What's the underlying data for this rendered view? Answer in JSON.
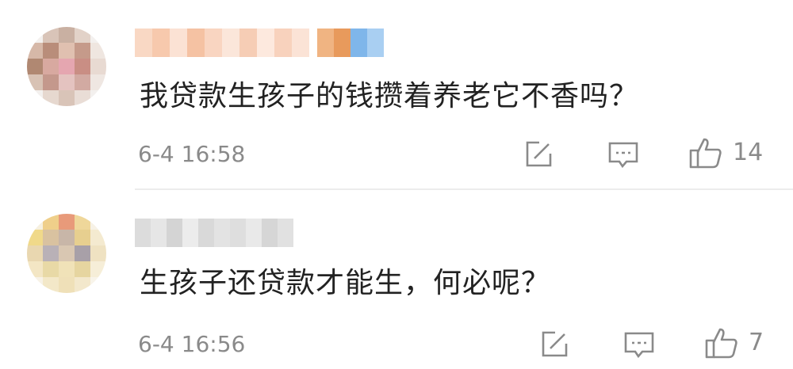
{
  "comments": [
    {
      "text": "我贷款生孩子的钱攒着养老它不香吗？",
      "time": "6-4 16:58",
      "likes": "14",
      "avatar_colors": [
        "#f3f0ee",
        "#d9c4b8",
        "#c9b0a2",
        "#e2d2c8",
        "#f3f0ee",
        "#d6b8a8",
        "#b98d7a",
        "#e0c0b0",
        "#c59a8a",
        "#efe6e0",
        "#b08872",
        "#d8a9a0",
        "#e5a6b0",
        "#c98e84",
        "#e8dad2",
        "#d8c2b4",
        "#c4988c",
        "#e4c3c0",
        "#d2aaa2",
        "#efe7e2",
        "#f3f0ee",
        "#e6d8cf",
        "#d9c4b8",
        "#e9ddd6",
        "#f3f0ee"
      ],
      "name_colors": [
        "#f9d8c4",
        "#f7c9ad",
        "#fbe2d4",
        "#f5c2a3",
        "#f9d5c1",
        "#fbe6da",
        "#f6cdb5",
        "#fde9de",
        "#f8d2bd",
        "#fbe3d6"
      ],
      "badge_colors": [
        "#f0b482",
        "#e89a5c",
        "#7fb6ea",
        "#a9cff2"
      ]
    },
    {
      "text": "生孩子还贷款才能生，何必呢？",
      "time": "6-4 16:56",
      "likes": "7",
      "avatar_colors": [
        "#f6f0e0",
        "#efcf8a",
        "#e89a7a",
        "#efd79a",
        "#f7f2e6",
        "#f0d98a",
        "#d9c2a0",
        "#c8b6a8",
        "#e7cf8f",
        "#f4ead0",
        "#e9d7b0",
        "#b9b1b7",
        "#d9c7b2",
        "#a8a0a8",
        "#efe2c2",
        "#f3e6c4",
        "#e8d9a6",
        "#f0e2b8",
        "#e6d5a0",
        "#f6eed8",
        "#f7f2e6",
        "#f3e8c8",
        "#efe0b8",
        "#f3e8cc",
        "#f8f4ea"
      ],
      "name_colors": [
        "#dcdcdc",
        "#e6e6e6",
        "#d4d4d4",
        "#ececec",
        "#d9d9d9",
        "#e3e3e3",
        "#dedede",
        "#e9e9e9",
        "#d6d6d6",
        "#e1e1e1"
      ]
    }
  ]
}
